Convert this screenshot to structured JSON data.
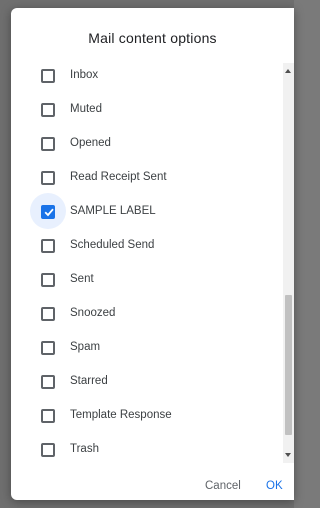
{
  "dialog": {
    "title": "Mail content options",
    "items": [
      {
        "label": "Inbox",
        "checked": false
      },
      {
        "label": "Muted",
        "checked": false
      },
      {
        "label": "Opened",
        "checked": false
      },
      {
        "label": "Read Receipt Sent",
        "checked": false
      },
      {
        "label": "SAMPLE LABEL",
        "checked": true
      },
      {
        "label": "Scheduled Send",
        "checked": false
      },
      {
        "label": "Sent",
        "checked": false
      },
      {
        "label": "Snoozed",
        "checked": false
      },
      {
        "label": "Spam",
        "checked": false
      },
      {
        "label": "Starred",
        "checked": false
      },
      {
        "label": "Template Response",
        "checked": false
      },
      {
        "label": "Trash",
        "checked": false
      }
    ],
    "cancel_label": "Cancel",
    "ok_label": "OK"
  },
  "colors": {
    "accent": "#1a73e8",
    "checked_halo": "#e8f0fe",
    "text": "#3c4043"
  }
}
